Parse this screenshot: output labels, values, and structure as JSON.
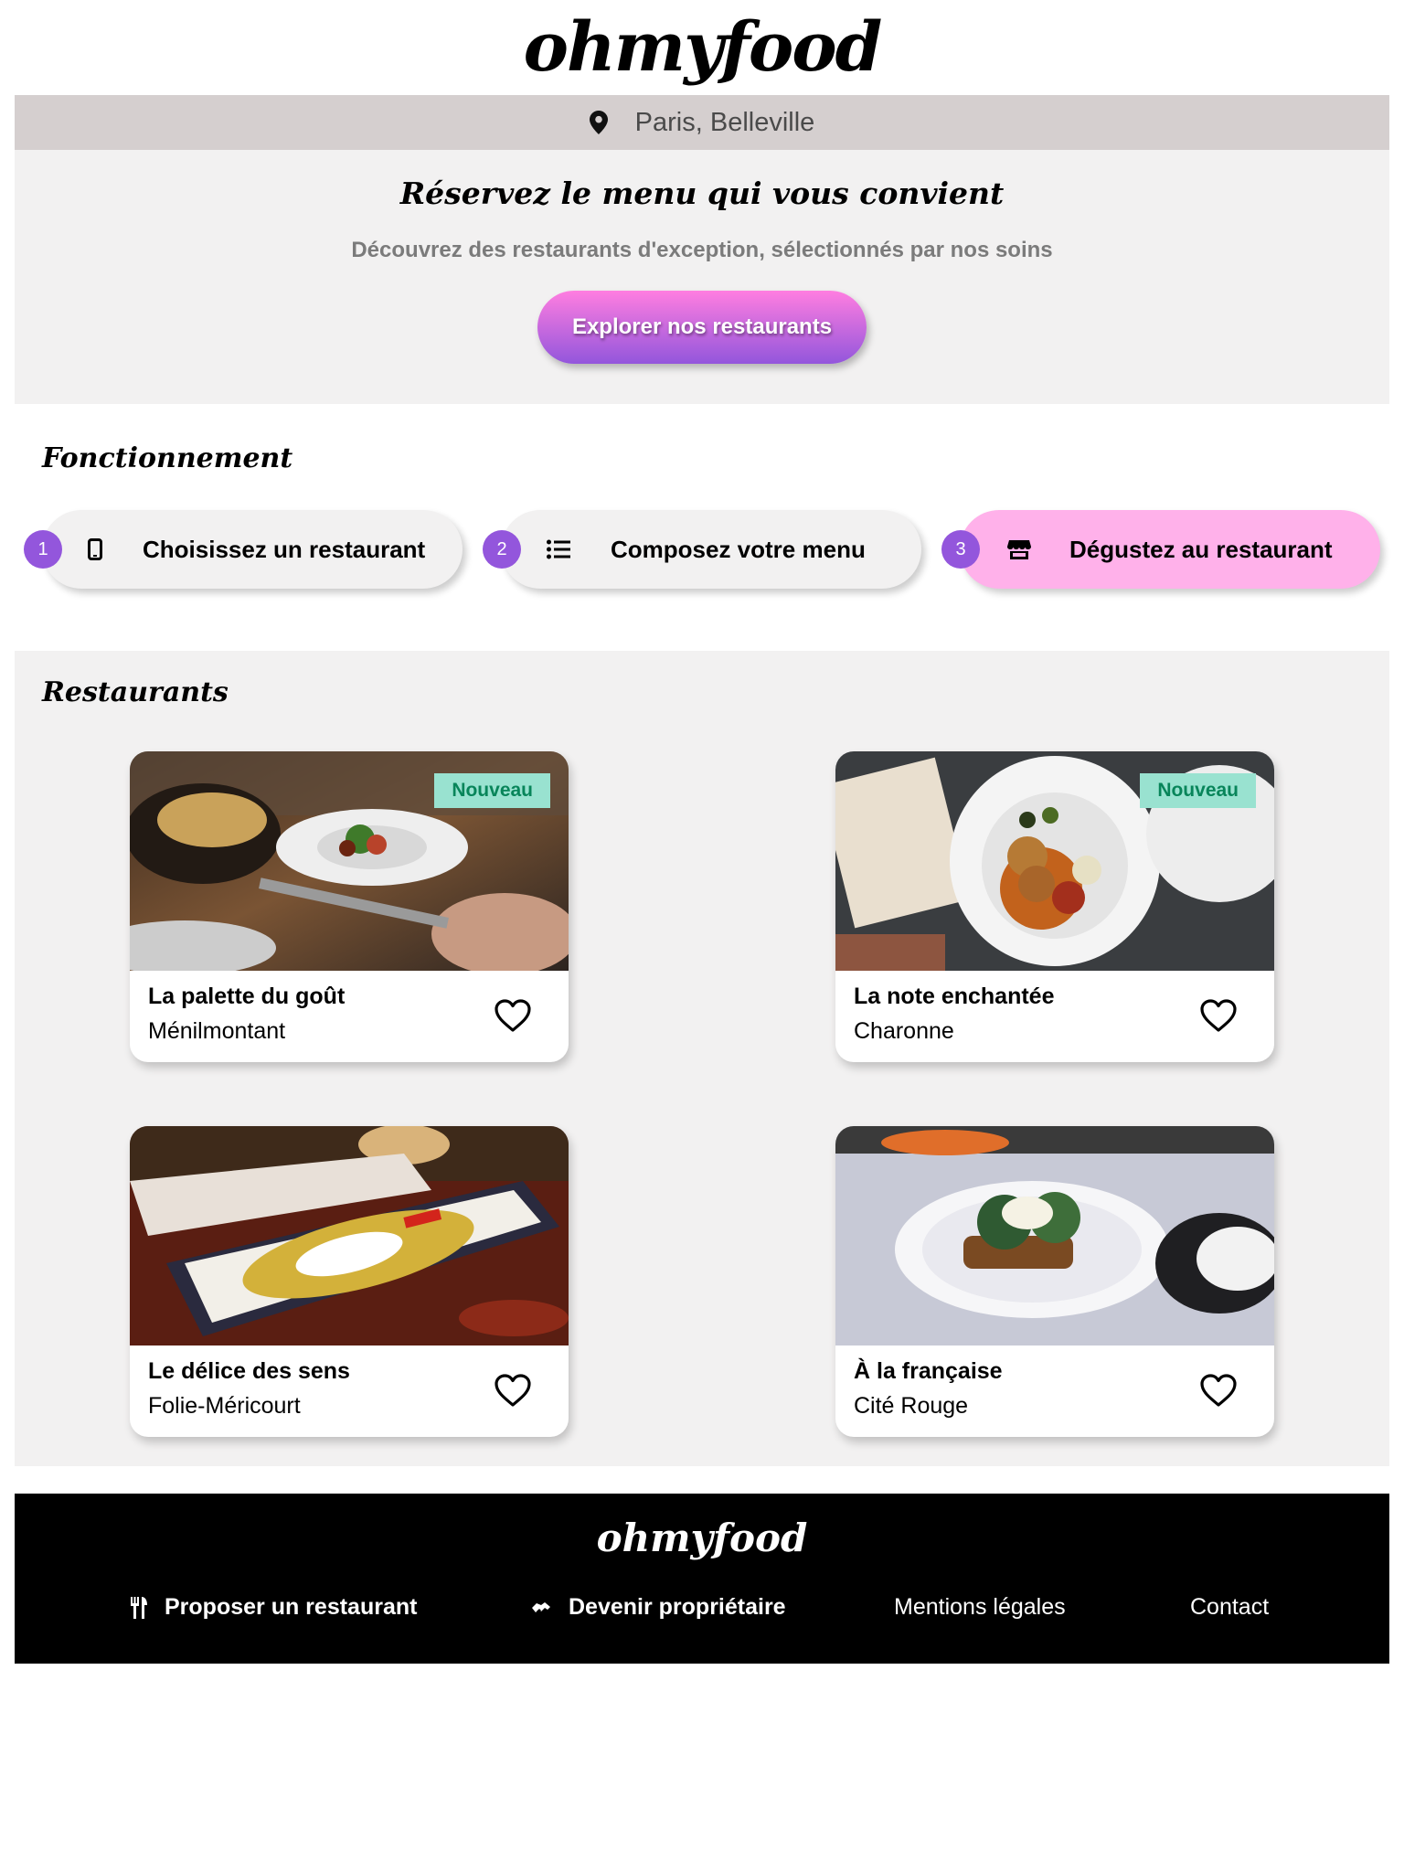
{
  "brand": {
    "name": "ohmyfood"
  },
  "location": {
    "label": "Paris, Belleville",
    "icon": "map-pin-icon"
  },
  "hero": {
    "title": "Réservez le menu qui vous convient",
    "subtitle": "Découvrez des restaurants d'exception, sélectionnés par nos soins",
    "cta_label": "Explorer nos restaurants"
  },
  "how_it_works": {
    "title": "Fonctionnement",
    "steps": [
      {
        "number": "1",
        "label": "Choisissez un restaurant",
        "icon": "mobile-phone-icon"
      },
      {
        "number": "2",
        "label": "Composez votre menu",
        "icon": "list-icon"
      },
      {
        "number": "3",
        "label": "Dégustez au restaurant",
        "icon": "store-icon",
        "highlighted": true
      }
    ]
  },
  "restaurants": {
    "title": "Restaurants",
    "items": [
      {
        "name": "La palette du goût",
        "area": "Ménilmontant",
        "badge": "Nouveau"
      },
      {
        "name": "La note enchantée",
        "area": "Charonne",
        "badge": "Nouveau"
      },
      {
        "name": "Le délice des sens",
        "area": "Folie-Méricourt"
      },
      {
        "name": "À la française",
        "area": "Cité Rouge"
      }
    ]
  },
  "footer": {
    "brand": "ohmyfood",
    "links": [
      {
        "label": "Proposer un restaurant",
        "icon": "utensils-icon"
      },
      {
        "label": "Devenir propriétaire",
        "icon": "handshake-icon"
      },
      {
        "label": "Mentions légales"
      },
      {
        "label": "Contact"
      }
    ]
  },
  "colors": {
    "accent_gradient_start": "#ff7ee0",
    "accent_gradient_end": "#9356dc",
    "step_number": "#9356dc",
    "step_highlight": "#ffb1ea",
    "badge_bg": "#99e2d0",
    "badge_text": "#08855a",
    "section_bg": "#f2f1f1"
  }
}
